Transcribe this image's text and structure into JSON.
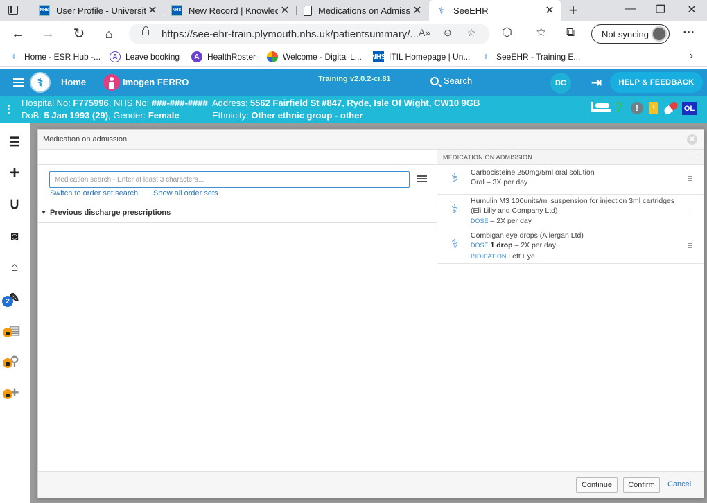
{
  "browser": {
    "tabs": [
      {
        "title": "User Profile - University",
        "icon": "nhs-icon"
      },
      {
        "title": "New Record | Knowledg",
        "icon": "nhs-icon"
      },
      {
        "title": "Medications on Admiss",
        "icon": "document-icon"
      },
      {
        "title": "SeeEHR",
        "icon": "seeehr-icon",
        "active": true
      }
    ],
    "url": "https://see-ehr-train.plymouth.nhs.uk/patientsummary/...",
    "sync_label": "Not syncing",
    "bookmarks": [
      {
        "label": "Home - ESR Hub -...",
        "icon": "seeehr-icon"
      },
      {
        "label": "Leave booking",
        "icon": "a-icon"
      },
      {
        "label": "HealthRoster",
        "icon": "a-purple-icon"
      },
      {
        "label": "Welcome - Digital L...",
        "icon": "wheel-icon"
      },
      {
        "label": "ITIL Homepage | Un...",
        "icon": "nhs-icon"
      },
      {
        "label": "SeeEHR - Training E...",
        "icon": "seeehr-icon"
      }
    ]
  },
  "app": {
    "home_label": "Home",
    "patient_name": "Imogen FERRO",
    "training_version": "Training v2.0.2-ci.81",
    "search_label": "Search",
    "user_initials": "DC",
    "help_label": "HELP & FEEDBACK"
  },
  "banner": {
    "hospital_prefix": "Hospital No: ",
    "hospital_no": "F775996",
    "nhs_prefix": ", NHS No: ",
    "nhs_no": "###-###-####",
    "address_prefix": "Address: ",
    "address": "5562 Fairfield St #847, Ryde, Isle Of Wight, CW10 9GB",
    "dob_prefix": "DoB: ",
    "dob": "5 Jan 1993 (29)",
    "gender_prefix": ", Gender: ",
    "gender": "Female",
    "ethnicity_prefix": "Ethnicity: ",
    "ethnicity": "Other ethnic group - other",
    "ol_badge": "OL",
    "clipboard_mark": "+"
  },
  "sidenav": {
    "notes_badge": "2"
  },
  "modal": {
    "title": "Medication on admission",
    "search_placeholder": "Medication search - Enter at least 3 characters...",
    "switch_link": "Switch to order set search",
    "show_all_link": "Show all order sets",
    "previous_discharge": "Previous discharge prescriptions",
    "list_title": "MEDICATION ON ADMISSION",
    "medications": [
      {
        "name": "Carbocisteine 250mg/5ml oral solution",
        "line1": "Oral – 3X per day"
      },
      {
        "name": "Humulin M3 100units/ml suspension for injection 3ml cartridges (Eli Lilly and Company Ltd)",
        "dose_label": "DOSE",
        "dose_text": " – 2X per day"
      },
      {
        "name": "Combigan eye drops (Allergan Ltd)",
        "dose_label": "DOSE",
        "dose_bold": "1 drop",
        "dose_text": " – 2X per day",
        "indication_label": "INDICATION",
        "indication": "Left Eye"
      }
    ],
    "continue_label": "Continue",
    "confirm_label": "Confirm",
    "cancel_label": "Cancel"
  }
}
